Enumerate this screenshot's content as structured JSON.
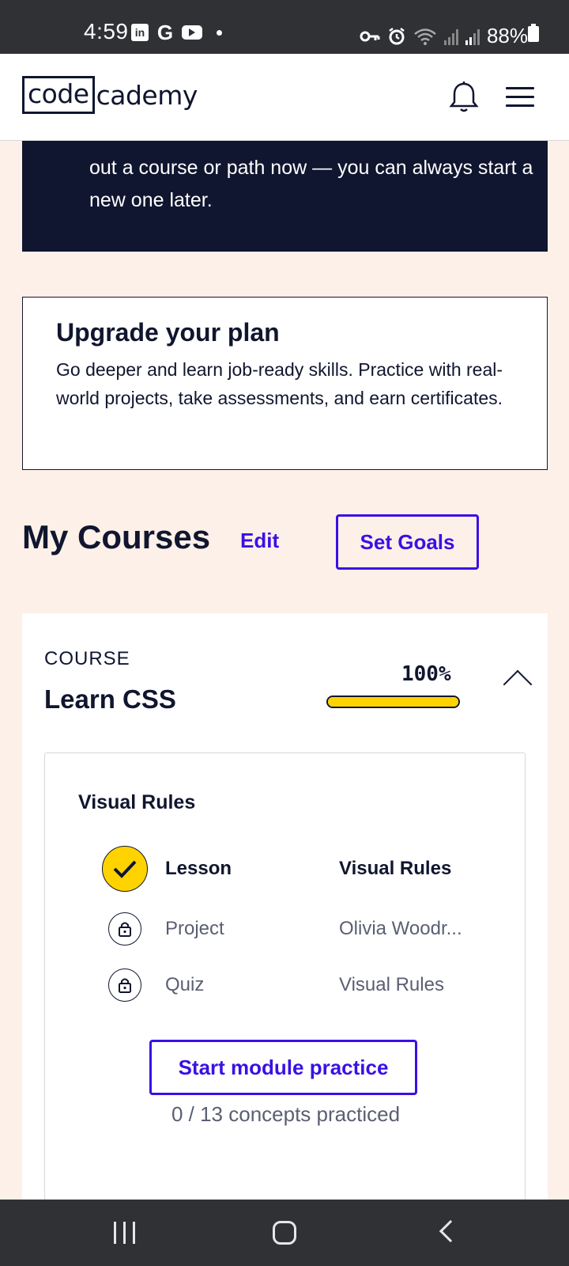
{
  "status_bar": {
    "time": "4:59",
    "battery": "88%",
    "app_icons": [
      "linkedin-icon",
      "google-icon",
      "youtube-icon",
      "notification-dot-icon"
    ],
    "system_icons": [
      "key-icon",
      "alarm-icon",
      "wifi-icon",
      "signal-icon",
      "signal-icon",
      "battery-icon"
    ]
  },
  "header": {
    "logo_boxed": "code",
    "logo_rest": "cademy",
    "icons": [
      "bell-icon",
      "menu-icon"
    ]
  },
  "banner": {
    "text": "out a course or path now — you can always start a new one later."
  },
  "upgrade": {
    "title": "Upgrade your plan",
    "body": "Go deeper and learn job-ready skills. Practice with real-world projects, take assessments, and earn certificates."
  },
  "my_courses": {
    "title": "My Courses",
    "edit_label": "Edit",
    "goals_label": "Set Goals"
  },
  "course": {
    "kicker": "COURSE",
    "name": "Learn CSS",
    "progress_label": "100%",
    "progress_fraction": 1.0,
    "colors": {
      "progress": "#ffd300",
      "accent": "#3a10e5"
    },
    "module": {
      "title": "Visual Rules",
      "items": [
        {
          "type": "Lesson",
          "name": "Visual Rules",
          "state": "complete",
          "icon": "check-icon"
        },
        {
          "type": "Project",
          "name": "Olivia Woodr...",
          "state": "locked",
          "icon": "lock-icon"
        },
        {
          "type": "Quiz",
          "name": "Visual Rules",
          "state": "locked",
          "icon": "lock-icon"
        }
      ],
      "practice_label": "Start module practice",
      "practice_meta": "0 / 13 concepts practiced"
    }
  },
  "nav_bar": {
    "icons": [
      "recent-apps-icon",
      "home-icon",
      "back-icon"
    ]
  }
}
